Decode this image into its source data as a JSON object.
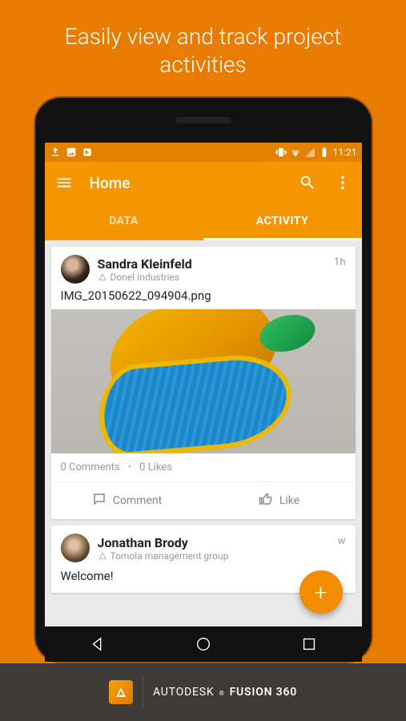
{
  "promo_headline": "Easily view and track project activities",
  "status_bar": {
    "time": "11:21"
  },
  "app_bar": {
    "title": "Home"
  },
  "tabs": [
    {
      "label": "DATA",
      "active": false
    },
    {
      "label": "ACTIVITY",
      "active": true
    }
  ],
  "feed": [
    {
      "user": {
        "name": "Sandra Kleinfeld",
        "org": "Donel Industries"
      },
      "time": "1h",
      "filename": "IMG_20150622_094904.png",
      "meta": {
        "comments": "0 Comments",
        "likes": "0 Likes"
      },
      "actions": {
        "comment": "Comment",
        "like": "Like"
      }
    },
    {
      "user": {
        "name": "Jonathan Brody",
        "org": "Tomola management group"
      },
      "time": "w",
      "body": "Welcome!"
    }
  ],
  "fab": {
    "label": "+"
  },
  "footer": {
    "brand_a": "AUTODESK",
    "brand_b": "FUSION 360"
  }
}
